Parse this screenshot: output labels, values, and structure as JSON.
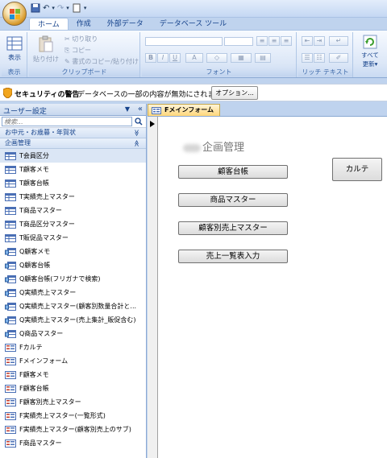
{
  "ribbon": {
    "tabs": [
      "ホーム",
      "作成",
      "外部データ",
      "データベース ツール"
    ],
    "groups": {
      "view": {
        "button": "表示",
        "label": "表示"
      },
      "clipboard": {
        "paste": "貼り付け",
        "cut": "切り取り",
        "copy": "コピー",
        "format_paint": "書式のコピー/貼り付け",
        "label": "クリップボード"
      },
      "font": {
        "bold": "B",
        "italic": "I",
        "underline": "U",
        "fontcolor": "A",
        "label": "フォント"
      },
      "richtext": {
        "label": "リッチ テキスト"
      },
      "records": {
        "refresh": "すべて",
        "refresh2": "更新"
      }
    }
  },
  "security": {
    "title": "セキュリティの警告",
    "message": "データベースの一部の内容が無効にされました",
    "options_button": "オプション..."
  },
  "nav": {
    "header": "ユーザー設定",
    "search_placeholder": "検索...",
    "categories": [
      {
        "label": "お中元・お歳暮・年賀状",
        "chevron": "≫"
      },
      {
        "label": "企画管理",
        "chevron": "≪"
      }
    ],
    "items": [
      {
        "label": "T会員区分",
        "type": "table"
      },
      {
        "label": "T顧客メモ",
        "type": "table"
      },
      {
        "label": "T顧客台帳",
        "type": "table"
      },
      {
        "label": "T実績売上マスター",
        "type": "table"
      },
      {
        "label": "T商品マスター",
        "type": "table"
      },
      {
        "label": "T商品区分マスター",
        "type": "table"
      },
      {
        "label": "T販促品マスター",
        "type": "table"
      },
      {
        "label": "Q顧客メモ",
        "type": "query"
      },
      {
        "label": "Q顧客台帳",
        "type": "query"
      },
      {
        "label": "Q顧客台帳(フリガナで検索)",
        "type": "query"
      },
      {
        "label": "Q実績売上マスター",
        "type": "query"
      },
      {
        "label": "Q実績売上マスター(顧客別数量合計と...",
        "type": "query"
      },
      {
        "label": "Q実績売上マスター(売上集計_販促含む)",
        "type": "query"
      },
      {
        "label": "Q商品マスター",
        "type": "query"
      },
      {
        "label": "Fカルテ",
        "type": "form"
      },
      {
        "label": "Fメインフォーム",
        "type": "form"
      },
      {
        "label": "F顧客メモ",
        "type": "form"
      },
      {
        "label": "F顧客台帳",
        "type": "form"
      },
      {
        "label": "F顧客別売上マスター",
        "type": "form"
      },
      {
        "label": "F実績売上マスター(一覧形式)",
        "type": "form"
      },
      {
        "label": "F実績売上マスター(顧客別売上のサブ)",
        "type": "form"
      },
      {
        "label": "F商品マスター",
        "type": "form"
      }
    ]
  },
  "document": {
    "tab_label": "Fメインフォーム",
    "form_title": "企画管理",
    "buttons": {
      "customer_ledger": "顧客台帳",
      "product_master": "商品マスター",
      "customer_sales_master": "顧客別売上マスター",
      "sales_list_input": "売上一覧表入力",
      "karte": "カルテ"
    }
  },
  "colors": {
    "ribbon_text": "#15428b",
    "doc_tab": "#ffd77a",
    "background": "#bfd3ee"
  }
}
